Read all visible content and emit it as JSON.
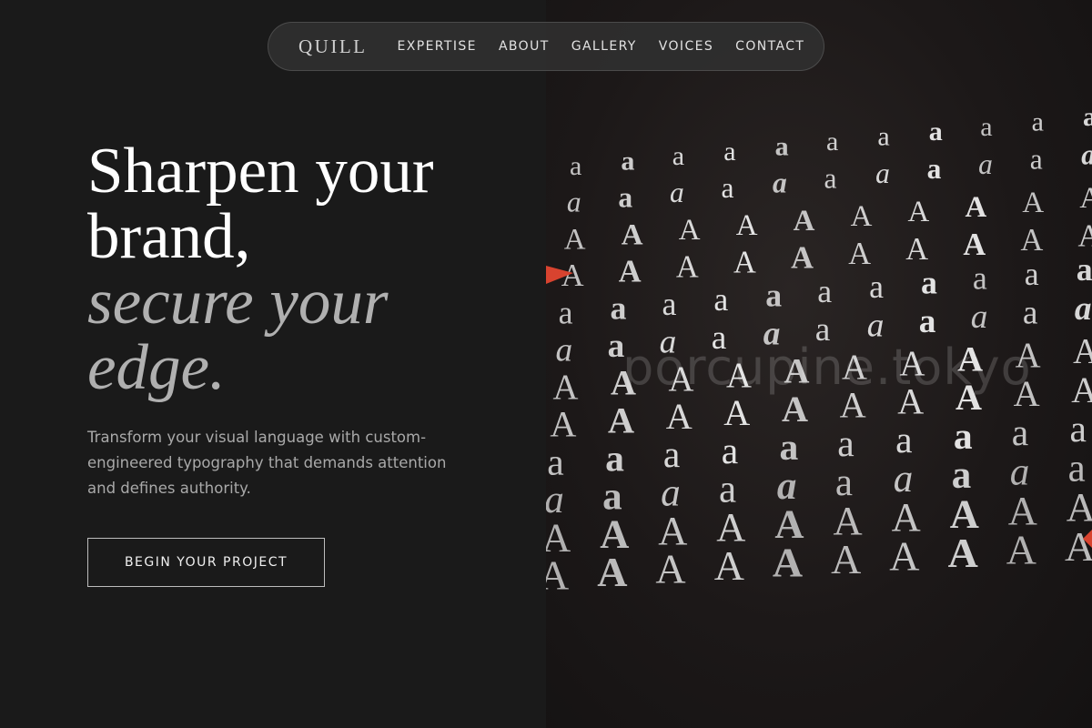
{
  "nav": {
    "logo": "QUILL",
    "links": [
      "EXPERTISE",
      "ABOUT",
      "GALLERY",
      "VOICES",
      "CONTACT"
    ]
  },
  "hero": {
    "headline_line1": "Sharpen your",
    "headline_line2": "brand,",
    "headline_line3": "secure your",
    "headline_line4": "edge.",
    "subtext": "Transform your visual language with custom-engineered typography that demands attention and defines authority.",
    "cta_label": "BEGIN YOUR PROJECT"
  },
  "image": {
    "watermark": "porcupine.tokyo",
    "rows": [
      "aaaaaaaaaaa",
      "aaaaaaaaaaa",
      "AAAAAAAAAA",
      "AAAAAAAAAA",
      "aaaaaaaaaaa",
      "aaaaaaaaaaa",
      "AAAAAAAAAA",
      "AAAAAAAAAA",
      "aaaaaaaaaa",
      "aaaaaaaaaa",
      "AAAAAAAAAA",
      "AAAAAAAAAA"
    ]
  },
  "colors": {
    "background": "#1a1a1a",
    "accent_red": "#d8432f",
    "text_primary": "#ffffff",
    "text_muted": "#a9a9a9"
  }
}
